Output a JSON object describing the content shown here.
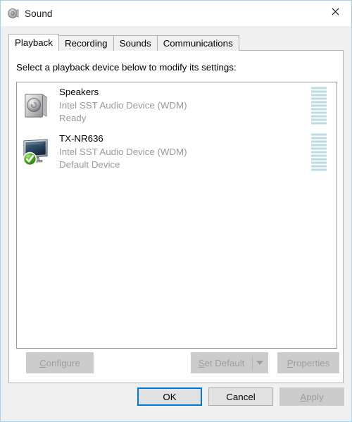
{
  "window": {
    "title": "Sound",
    "title_icon": "speaker-icon",
    "close_label": "×",
    "border_color": "#a8d2ec"
  },
  "tabs": [
    {
      "label": "Playback",
      "active": true
    },
    {
      "label": "Recording",
      "active": false
    },
    {
      "label": "Sounds",
      "active": false
    },
    {
      "label": "Communications",
      "active": false
    }
  ],
  "playback": {
    "prompt": "Select a playback device below to modify its settings:",
    "devices": [
      {
        "name": "Speakers",
        "driver": "Intel SST Audio Device (WDM)",
        "status": "Ready",
        "icon": "speaker-device-icon",
        "is_default": false,
        "meter_segments": 11,
        "meter_color": "#bcdbe5"
      },
      {
        "name": "TX-NR636",
        "driver": "Intel SST Audio Device (WDM)",
        "status": "Default Device",
        "icon": "monitor-device-icon",
        "is_default": true,
        "meter_segments": 11,
        "meter_color": "#bcdbe5"
      }
    ],
    "actions": {
      "configure": {
        "label": "Configure",
        "accel": "C",
        "enabled": false
      },
      "set_default": {
        "label": "Set Default",
        "accel": "S",
        "enabled": false
      },
      "set_default_dropdown": {
        "icon": "chevron-down-icon",
        "enabled": false
      },
      "properties": {
        "label": "Properties",
        "accel": "P",
        "enabled": false
      }
    }
  },
  "footer": {
    "ok": {
      "label": "OK",
      "enabled": true,
      "is_default": true,
      "focus_color": "#0078d7"
    },
    "cancel": {
      "label": "Cancel",
      "enabled": true
    },
    "apply": {
      "label": "Apply",
      "accel": "A",
      "enabled": false
    }
  }
}
